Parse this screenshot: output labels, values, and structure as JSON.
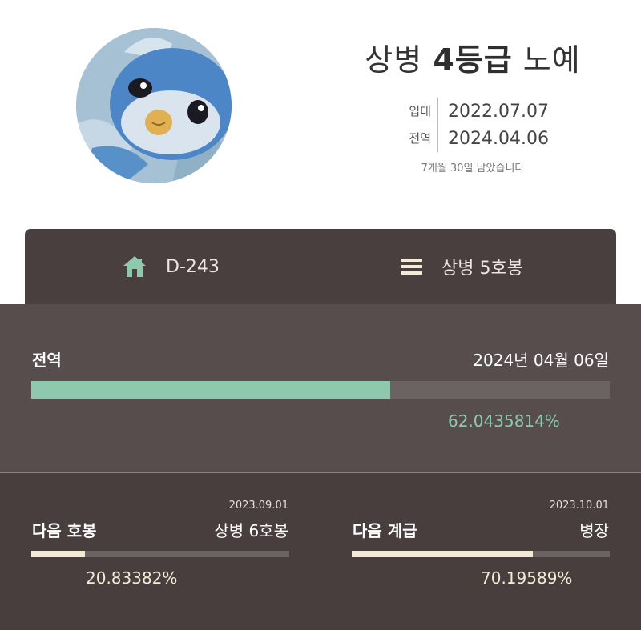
{
  "header": {
    "rank_prefix": "상병",
    "rank_bold": "4등급",
    "rank_suffix": "노예",
    "enlist_label": "입대",
    "enlist_date": "2022.07.07",
    "discharge_label": "전역",
    "discharge_date": "2024.04.06",
    "remaining_text": "7개월 30일 남았습니다"
  },
  "tabs": {
    "dday": {
      "icon": "home-icon",
      "label": "D-243"
    },
    "rank": {
      "icon": "menu-icon",
      "label": "상병 5호봉"
    }
  },
  "discharge_progress": {
    "label": "전역",
    "date_text": "2024년 04월 06일",
    "percent_text": "62.0435814%",
    "fraction": 0.620435814
  },
  "next_step": {
    "label": "다음 호봉",
    "date": "2023.09.01",
    "target": "상병 6호봉",
    "percent_text": "20.83382%",
    "fraction": 0.2083382
  },
  "next_rank": {
    "label": "다음 계급",
    "date": "2023.10.01",
    "target": "병장",
    "percent_text": "70.19589%",
    "fraction": 0.7019589
  },
  "colors": {
    "green": "#8fc9ad",
    "cream": "#f4ead5",
    "bar_dark": "#493f3f",
    "panel": "#574d4d"
  }
}
